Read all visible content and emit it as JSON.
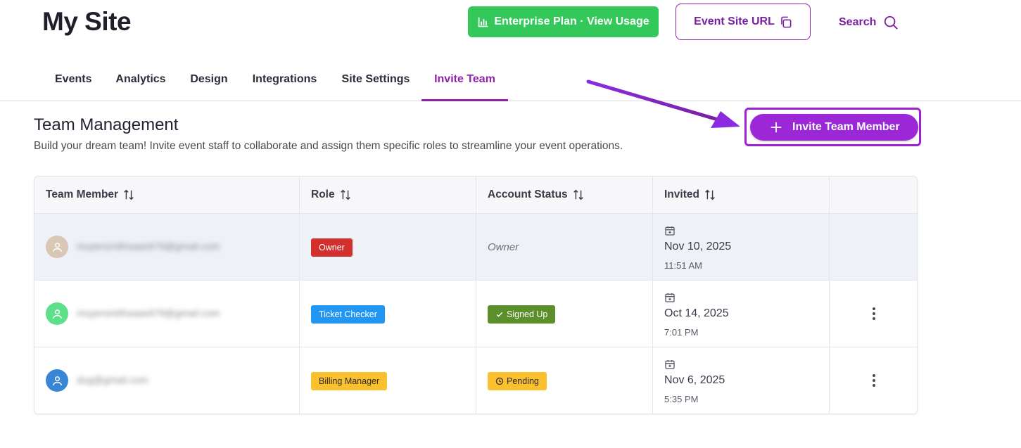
{
  "header": {
    "site_title": "My Site",
    "plan_button": "Enterprise Plan · View Usage",
    "event_url_button": "Event Site URL",
    "search_label": "Search"
  },
  "tabs": [
    {
      "label": "Events"
    },
    {
      "label": "Analytics"
    },
    {
      "label": "Design"
    },
    {
      "label": "Integrations"
    },
    {
      "label": "Site Settings"
    },
    {
      "label": "Invite Team",
      "active": true
    }
  ],
  "section": {
    "title": "Team Management",
    "description": "Build your dream team! Invite event staff to collaborate and assign them specific roles to streamline your event operations.",
    "invite_button": "Invite Team Member"
  },
  "table": {
    "columns": [
      "Team Member",
      "Role",
      "Account Status",
      "Invited"
    ],
    "rows": [
      {
        "email": "mcpersmithsaas979@gmail.com",
        "role": "Owner",
        "status": "Owner",
        "status_type": "text",
        "date": "Nov 10, 2025",
        "time": "11:51 AM",
        "avatar_color": "#d8c7b5"
      },
      {
        "email": "mcpersmithsaas979@gmail.com",
        "role": "Ticket Checker",
        "status": "Signed Up",
        "status_type": "badge",
        "date": "Oct 14, 2025",
        "time": "7:01 PM",
        "avatar_color": "#5ee08a"
      },
      {
        "email": "dug@gmail.com",
        "role": "Billing Manager",
        "status": "Pending",
        "status_type": "badge",
        "date": "Nov 6, 2025",
        "time": "5:35 PM",
        "avatar_color": "#3a86d6"
      }
    ]
  },
  "colors": {
    "accent": "#8e24aa",
    "plan_green": "#34c759",
    "owner_red": "#d32f2f",
    "ticket_blue": "#2196f3",
    "billing_yellow": "#fbc02d",
    "signed_green": "#5a8f2a"
  },
  "icons": [
    "chart-icon",
    "copy-icon",
    "search-icon",
    "plus-icon",
    "sort-icon",
    "user-icon",
    "calendar-icon",
    "check-icon",
    "clock-icon",
    "more-vertical-icon"
  ]
}
